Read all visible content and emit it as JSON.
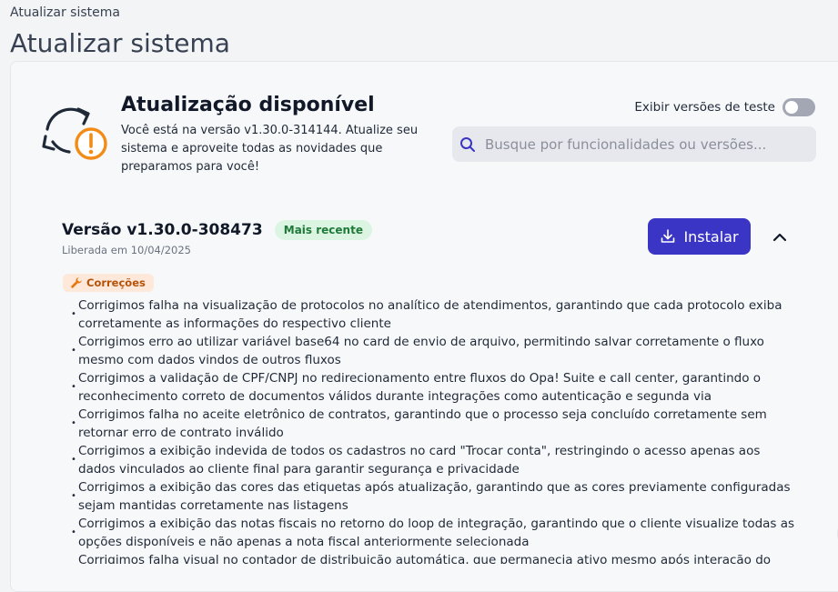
{
  "breadcrumb": "Atualizar sistema",
  "page_title": "Atualizar sistema",
  "hero": {
    "title": "Atualização disponível",
    "description": "Você está na versão v1.30.0-314144. Atualize seu sistema e aproveite todas as novidades que preparamos para você!",
    "icon": "update-warning-icon"
  },
  "test_toggle": {
    "label": "Exibir versões de teste",
    "checked": false
  },
  "search": {
    "placeholder": "Busque por funcionalidades ou versões..."
  },
  "version": {
    "title": "Versão v1.30.0-308473",
    "badge": "Mais recente",
    "released": "Liberada em 10/04/2025",
    "install_label": "Instalar",
    "tag_label": "Correções",
    "changes": [
      "Corrigimos falha na visualização de protocolos no analítico de atendimentos, garantindo que cada protocolo exiba corretamente as informações do respectivo cliente",
      "Corrigimos erro ao utilizar variável base64 no card de envio de arquivo, permitindo salvar corretamente o fluxo mesmo com dados vindos de outros fluxos",
      "Corrigimos a validação de CPF/CNPJ no redirecionamento entre fluxos do Opa! Suite e call center, garantindo o reconhecimento correto de documentos válidos durante integrações como autenticação e segunda via",
      "Corrigimos falha no aceite eletrônico de contratos, garantindo que o processo seja concluído corretamente sem retornar erro de contrato inválido",
      "Corrigimos a exibição indevida de todos os cadastros no card \"Trocar conta\", restringindo o acesso apenas aos dados vinculados ao cliente final para garantir segurança e privacidade",
      "Corrigimos a exibição das cores das etiquetas após atualização, garantindo que as cores previamente configuradas sejam mantidas corretamente nas listagens",
      "Corrigimos a exibição das notas fiscais no retorno do loop de integração, garantindo que o cliente visualize todas as opções disponíveis e não apenas a nota fiscal anteriormente selecionada",
      "Corrigimos falha visual no contador de distribuição automática, que permanecia ativo mesmo após interação do"
    ]
  },
  "colors": {
    "accent": "#3a35c4",
    "badge_bg": "#dcf5e2",
    "tag_bg": "#fde8d9",
    "warning": "#f28c18"
  }
}
